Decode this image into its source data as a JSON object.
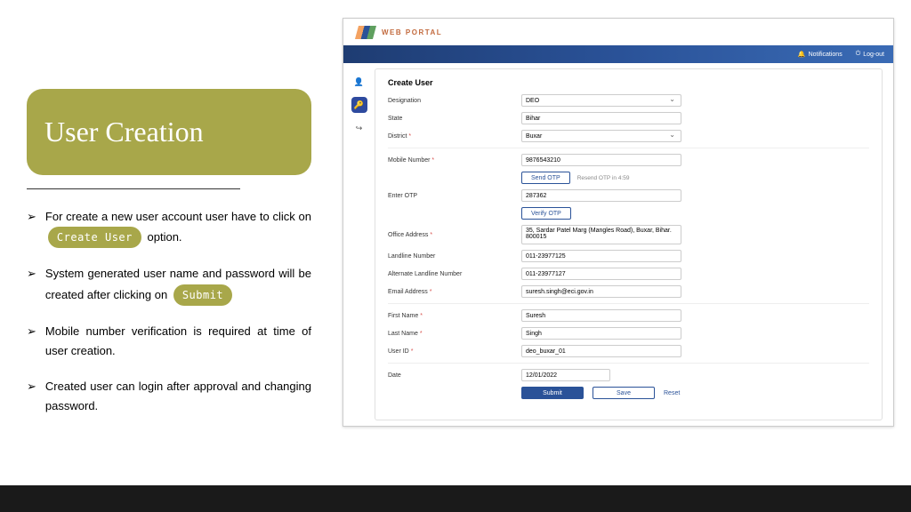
{
  "leftPanel": {
    "title": "User Creation",
    "bullets": {
      "b1_pre": "For create a new user account user have to click on ",
      "b1_pill": "Create User",
      "b1_post": " option.",
      "b2_pre": "System generated user name and password will be created after clicking on ",
      "b2_pill": "Submit",
      "b3": "Mobile number verification is required at time of user creation.",
      "b4": "Created user can login after approval and changing password."
    }
  },
  "portal": {
    "brand": "WEB PORTAL",
    "notifications": "Notifications",
    "logout": "Log-out"
  },
  "form": {
    "title": "Create User",
    "labels": {
      "designation": "Designation",
      "state": "State",
      "district": "District",
      "mobile": "Mobile Number",
      "enterOtp": "Enter OTP",
      "office": "Office Address",
      "landline": "Landline Number",
      "altLandline": "Alternate Landline Number",
      "email": "Email Address",
      "firstName": "First Name",
      "lastName": "Last Name",
      "userId": "User ID",
      "date": "Date"
    },
    "values": {
      "designation": "DEO",
      "state": "Bihar",
      "district": "Buxar",
      "mobile": "9876543210",
      "otp": "287362",
      "office": "35, Sardar Patel Marg (Mangles Road), Buxar, Bihar. 800015",
      "landline": "011-23977125",
      "altLandline": "011-23977127",
      "email": "suresh.singh@eci.gov.in",
      "firstName": "Suresh",
      "lastName": "Singh",
      "userId": "deo_buxar_01",
      "date": "12/01/2022"
    },
    "buttons": {
      "sendOtp": "Send OTP",
      "resendHelper": "Resend OTP in 4:59",
      "verifyOtp": "Verify OTP",
      "submit": "Submit",
      "save": "Save",
      "reset": "Reset"
    }
  }
}
